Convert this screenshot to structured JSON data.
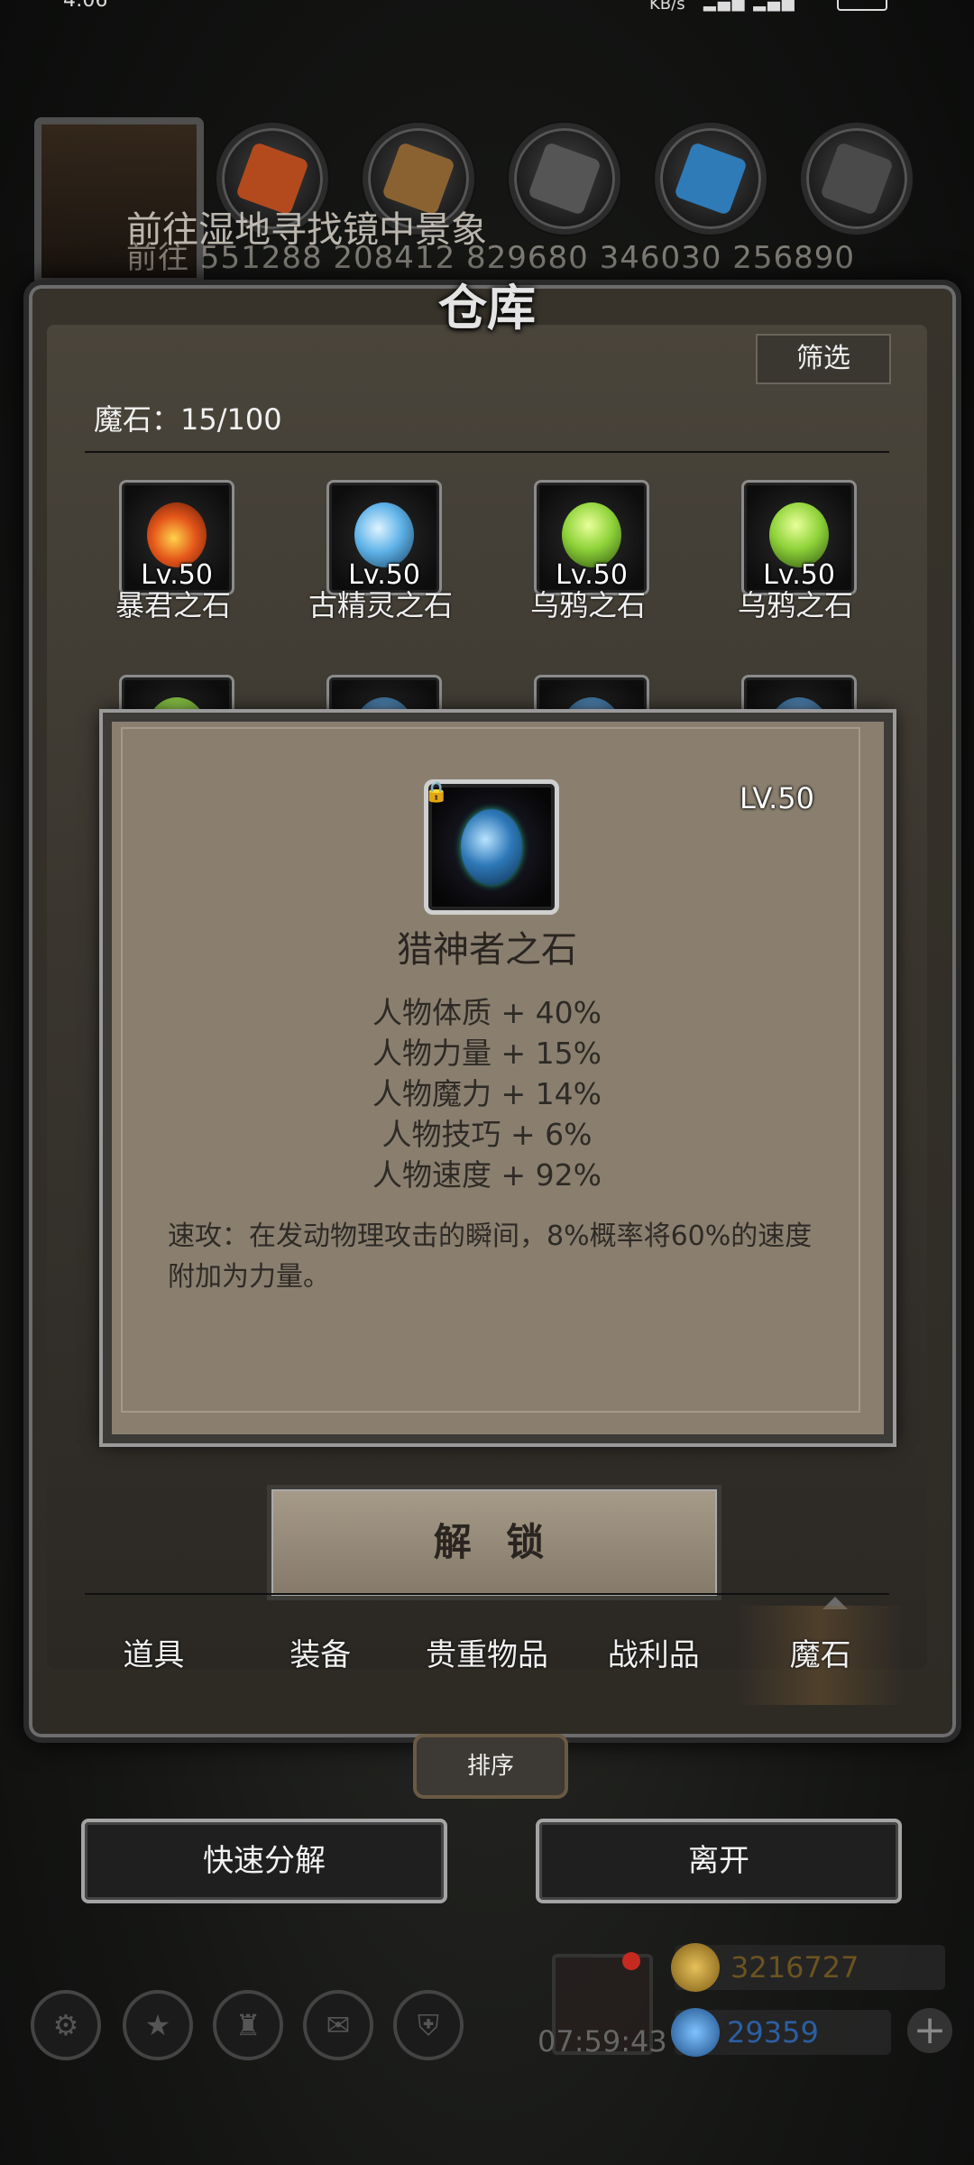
{
  "status_bar": {
    "time": "4:06",
    "speed": "KB/s"
  },
  "top": {
    "quest": "前往湿地寻找镜中景象",
    "coords": "前往  551288  208412  829680  346030  256890"
  },
  "panel": {
    "title": "仓库",
    "filter_label": "筛选",
    "magic_count": "魔石：15/100"
  },
  "items": [
    {
      "name": "暴君之石",
      "level": "Lv.50",
      "color": "#d2451b"
    },
    {
      "name": "古精灵之石",
      "level": "Lv.50",
      "color": "#5fb2e8"
    },
    {
      "name": "乌鸦之石",
      "level": "Lv.50",
      "color": "#8fd33a"
    },
    {
      "name": "乌鸦之石",
      "level": "Lv.50",
      "color": "#8fd33a"
    }
  ],
  "detail": {
    "level": "LV.50",
    "name": "猎神者之石",
    "stats": [
      "人物体质 + 40%",
      "人物力量 + 15%",
      "人物魔力 + 14%",
      "人物技巧 + 6%",
      "人物速度 + 92%"
    ],
    "skill": "速攻：在发动物理攻击的瞬间，8%概率将60%的速度附加为力量。"
  },
  "unlock_label": "解 锁",
  "tabs": [
    "道具",
    "装备",
    "贵重物品",
    "战利品",
    "魔石"
  ],
  "active_tab": "魔石",
  "sort_label": "排序",
  "quick_decompose_label": "快速分解",
  "leave_label": "离开",
  "hud": {
    "timer": "07:59:43",
    "gold": "3216727",
    "gems": "29359",
    "gold_color": "#6b5320",
    "gems_color": "#2c5fa3"
  }
}
